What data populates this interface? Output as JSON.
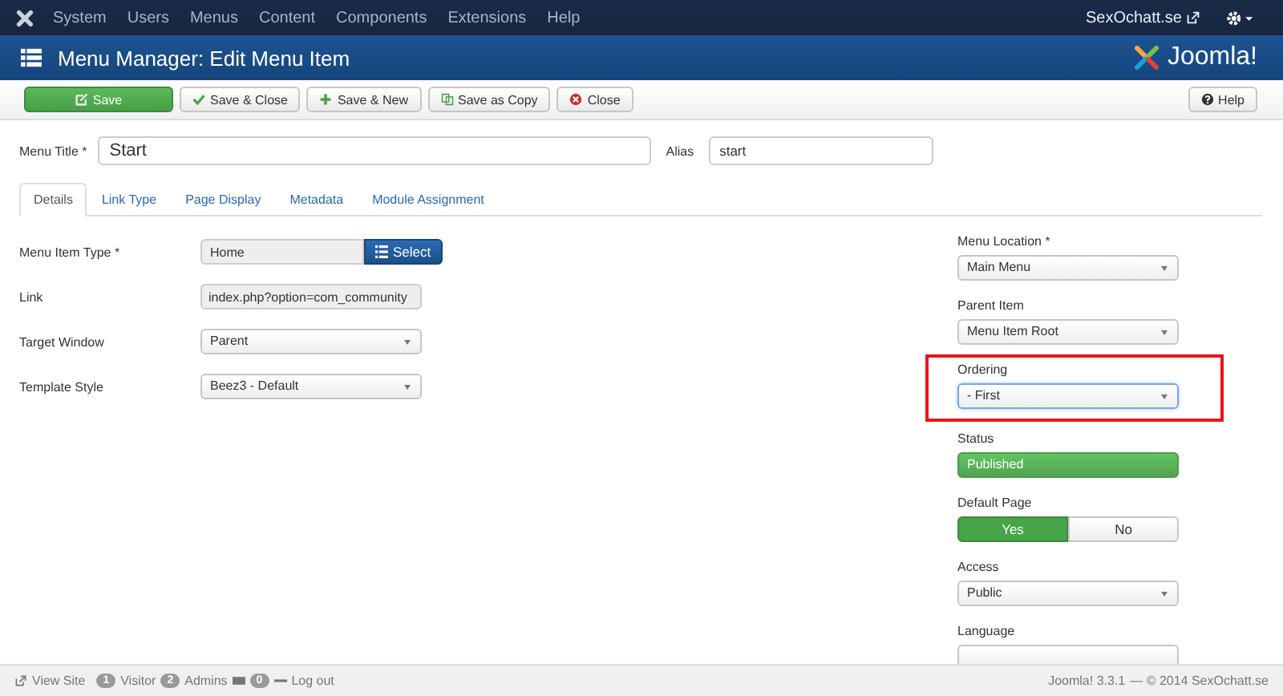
{
  "top_menu": {
    "items": [
      "System",
      "Users",
      "Menus",
      "Content",
      "Components",
      "Extensions",
      "Help"
    ],
    "site_link": "SexOchatt.se"
  },
  "header": {
    "title": "Menu Manager: Edit Menu Item",
    "logo_text": "Joomla!"
  },
  "toolbar": {
    "buttons": [
      {
        "label": "Save",
        "kind": "primary"
      },
      {
        "label": "Save & Close",
        "kind": "check"
      },
      {
        "label": "Save & New",
        "kind": "plus"
      },
      {
        "label": "Save as Copy",
        "kind": "copy"
      },
      {
        "label": "Close",
        "kind": "close"
      }
    ],
    "help": "Help"
  },
  "title_field": {
    "label": "Menu Title *",
    "value": "Start"
  },
  "alias_field": {
    "label": "Alias",
    "value": "start"
  },
  "tabs": [
    {
      "label": "Details",
      "selected": true
    },
    {
      "label": "Link Type",
      "selected": false
    },
    {
      "label": "Page Display",
      "selected": false
    },
    {
      "label": "Metadata",
      "selected": false
    },
    {
      "label": "Module Assignment",
      "selected": false
    }
  ],
  "details": [
    {
      "label": "Menu Item Type *",
      "kind": "picker",
      "value": "Home",
      "button": "Select"
    },
    {
      "label": "Link",
      "kind": "readonly",
      "value": "index.php?option=com_community"
    },
    {
      "label": "Target Window",
      "kind": "select",
      "value": "Parent"
    },
    {
      "label": "Template Style",
      "kind": "select",
      "value": "Beez3 - Default"
    }
  ],
  "side_fields": [
    {
      "label": "Menu Location *",
      "kind": "select",
      "value": "Main Menu"
    },
    {
      "label": "Parent Item",
      "kind": "select",
      "value": "Menu Item Root"
    },
    {
      "label": "Ordering",
      "kind": "select",
      "value": "- First",
      "highlighted": true
    },
    {
      "label": "Status",
      "kind": "status",
      "value": "Published"
    },
    {
      "label": "Default Page",
      "kind": "toggle",
      "options": [
        {
          "label": "Yes",
          "selected": true
        },
        {
          "label": "No",
          "selected": false
        }
      ]
    },
    {
      "label": "Access",
      "kind": "select",
      "value": "Public"
    },
    {
      "label": "Language",
      "kind": "select"
    }
  ],
  "status_bar": {
    "view_site": "View Site",
    "visitors_count": "1",
    "visitors": "Visitor",
    "admins_count": "2",
    "admins": "Admins",
    "messages_count": "0",
    "logout": "Log out",
    "version": "Joomla! 3.3.1",
    "copyright": "— © 2014 SexOchatt.se"
  }
}
